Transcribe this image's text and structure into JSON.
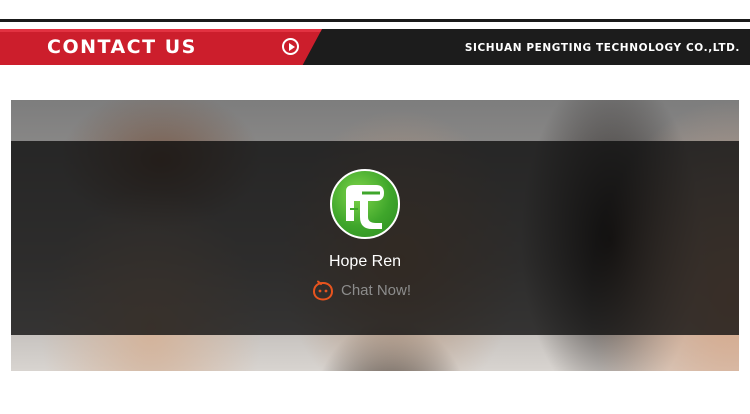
{
  "header": {
    "title": "CONTACT US",
    "play_icon": "play-circle-icon",
    "company": "SICHUAN PENGTING TECHNOLOGY CO.,LTD."
  },
  "contact": {
    "agent_name": "Hope Ren",
    "avatar_icon": "pengting-t-logo-icon",
    "chat_label": "Chat Now!",
    "chat_icon": "chat-bubble-icon"
  },
  "colors": {
    "accent_red": "#cc1e2c",
    "header_dark": "#1c1c1c",
    "avatar_green": "#3fa62b",
    "chat_orange": "#e8541e"
  }
}
